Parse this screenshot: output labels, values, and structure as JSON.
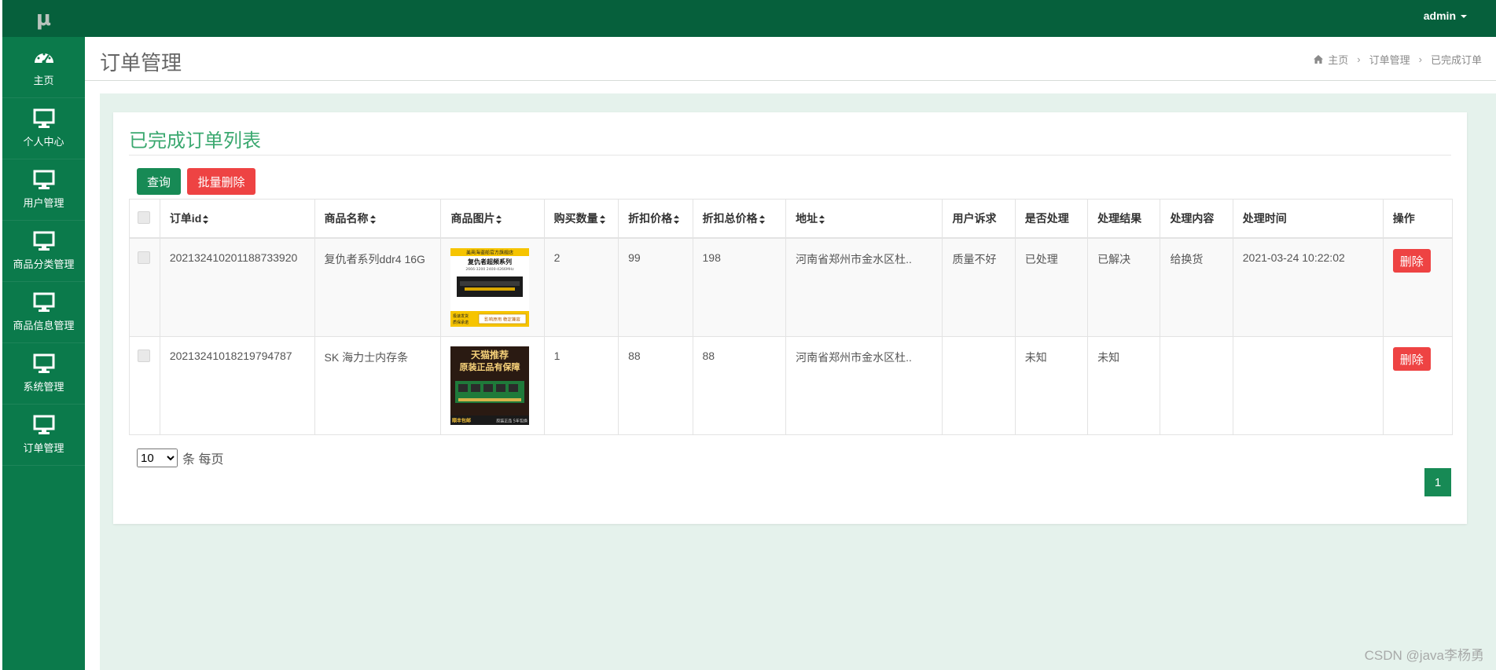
{
  "logo": "μ",
  "sidebar": {
    "items": [
      {
        "label": "主页",
        "icon": "dashboard-icon"
      },
      {
        "label": "个人中心",
        "icon": "monitor-icon"
      },
      {
        "label": "用户管理",
        "icon": "monitor-icon"
      },
      {
        "label": "商品分类管理",
        "icon": "monitor-icon"
      },
      {
        "label": "商品信息管理",
        "icon": "monitor-icon"
      },
      {
        "label": "系统管理",
        "icon": "monitor-icon"
      },
      {
        "label": "订单管理",
        "icon": "monitor-icon"
      }
    ]
  },
  "topbar": {
    "user": "admin"
  },
  "header": {
    "title": "订单管理",
    "breadcrumb": [
      "主页",
      "订单管理",
      "已完成订单"
    ]
  },
  "card": {
    "title": "已完成订单列表",
    "query_label": "查询",
    "batch_delete_label": "批量删除"
  },
  "table": {
    "columns": [
      "订单id",
      "商品名称",
      "商品图片",
      "购买数量",
      "折扣价格",
      "折扣总价格",
      "地址",
      "用户诉求",
      "是否处理",
      "处理结果",
      "处理内容",
      "处理时间",
      "操作"
    ],
    "rows": [
      {
        "order_id": "202132410201188733920",
        "product_name": "复仇者系列ddr4 16G",
        "quantity": "2",
        "price": "99",
        "total": "198",
        "address": "河南省郑州市金水区杜..",
        "appeal": "质量不好",
        "processed": "已处理",
        "result": "已解决",
        "content": "给换货",
        "time": "2021-03-24 10:22:02",
        "delete_label": "删除",
        "image": {
          "top": "美商海盗船官方旗舰店",
          "title": "复仇者超频系列",
          "spec": "2666-3200 2400-4266MHz",
          "tags": [
            "极速发货",
            "质保承诺"
          ],
          "badge": "影响原用 稳定兼容"
        }
      },
      {
        "order_id": "20213241018219794787",
        "product_name": "SK 海力士内存条",
        "quantity": "1",
        "price": "88",
        "total": "88",
        "address": "河南省郑州市金水区杜..",
        "appeal": "",
        "processed": "未知",
        "result": "未知",
        "content": "",
        "time": "",
        "delete_label": "删除",
        "image": {
          "line1": "天猫推荐",
          "line2": "原装正品有保障",
          "footer_left": "顺丰包邮",
          "footer_right": "原装正品 5年包换"
        }
      }
    ]
  },
  "pagination": {
    "page_size": "10",
    "page_size_suffix": "条 每页",
    "current_page": "1"
  },
  "watermark": "CSDN @java李杨勇",
  "colors": {
    "sidebar": "#0b7a4b",
    "topbar": "#06603c",
    "primary": "#178a55",
    "danger": "#ee4343",
    "title": "#3aa86f",
    "content_bg": "#e5f2ec"
  }
}
